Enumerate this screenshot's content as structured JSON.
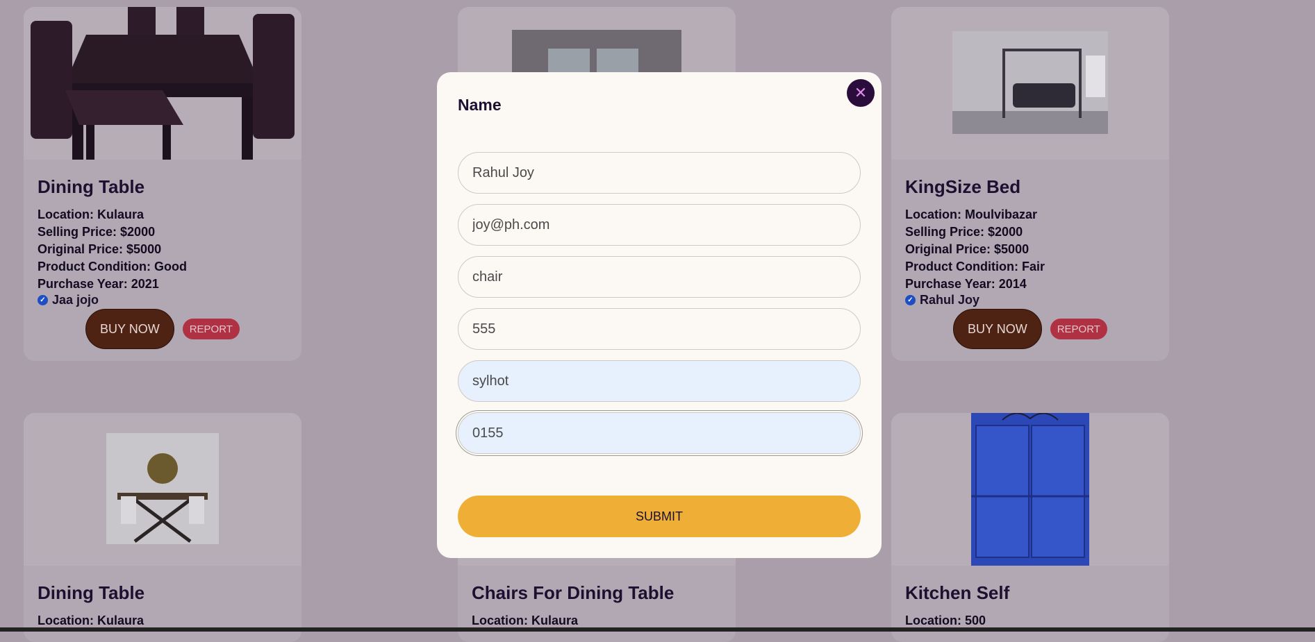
{
  "cards": [
    {
      "title": "Dining Table",
      "location": "Location: Kulaura",
      "selling_price": "Selling Price: $2000",
      "original_price": "Original Price: $5000",
      "condition": "Product Condition: Good",
      "purchase_year": "Purchase Year: 2021",
      "seller": "Jaa jojo",
      "buy_label": "BUY NOW",
      "report_label": "REPORT"
    },
    {
      "title": "KingSize Bed",
      "location": "Location: Moulvibazar",
      "selling_price": "Selling Price: $2000",
      "original_price": "Original Price: $5000",
      "condition": "Product Condition: Fair",
      "purchase_year": "Purchase Year: 2014",
      "seller": "Rahul Joy",
      "buy_label": "BUY NOW",
      "report_label": "REPORT"
    },
    {
      "title": "Dining Table",
      "location": "Location: Kulaura"
    },
    {
      "title": "Chairs For Dining Table",
      "location": "Location: Kulaura"
    },
    {
      "title": "Kitchen Self",
      "location": "Location: 500"
    }
  ],
  "modal": {
    "title": "Name",
    "close_glyph": "✕",
    "fields": [
      {
        "value": "Rahul Joy"
      },
      {
        "value": "joy@ph.com"
      },
      {
        "value": "chair"
      },
      {
        "value": "555"
      },
      {
        "value": "sylhot"
      },
      {
        "value": "0155"
      }
    ],
    "submit_label": "SUBMIT"
  },
  "icons": {
    "verified": "verified-check-icon",
    "close": "close-icon"
  },
  "colors": {
    "backdrop": "#a99ea9",
    "modal_bg": "#fcf8f4",
    "submit": "#efaf36",
    "buy_button": "#4e2314",
    "report_button": "#b03143",
    "close_button": "#2a0d3a"
  }
}
